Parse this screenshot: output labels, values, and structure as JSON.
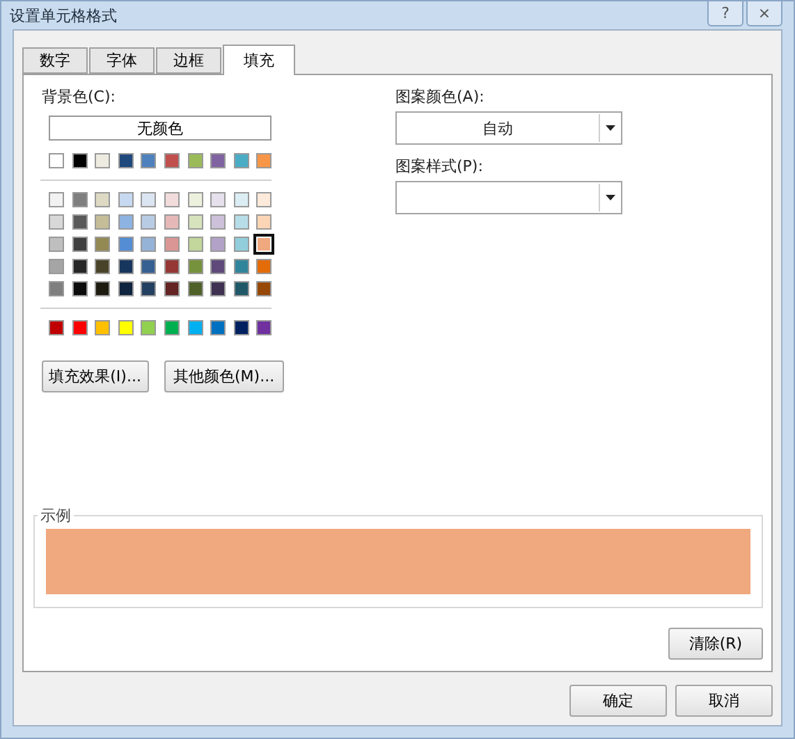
{
  "window": {
    "title": "设置单元格格式",
    "help": "?",
    "close": "×"
  },
  "tabs": [
    {
      "label": "数字",
      "selected": false
    },
    {
      "label": "字体",
      "selected": false
    },
    {
      "label": "边框",
      "selected": false
    },
    {
      "label": "填充",
      "selected": true
    }
  ],
  "background": {
    "label": "背景色(C):",
    "no_color": "无颜色",
    "theme_row": [
      {
        "color": "#ffffff",
        "selected": false
      },
      {
        "color": "#000000",
        "selected": false
      },
      {
        "color": "#eeece1",
        "selected": false
      },
      {
        "color": "#1f497d",
        "selected": false
      },
      {
        "color": "#4f81bd",
        "selected": false
      },
      {
        "color": "#c0504d",
        "selected": false
      },
      {
        "color": "#9bbb59",
        "selected": false
      },
      {
        "color": "#8064a2",
        "selected": false
      },
      {
        "color": "#4bacc6",
        "selected": false
      },
      {
        "color": "#f79646",
        "selected": false
      }
    ],
    "tint_rows": [
      [
        {
          "color": "#f2f2f2",
          "selected": false
        },
        {
          "color": "#7f7f7f",
          "selected": false
        },
        {
          "color": "#ddd9c3",
          "selected": false
        },
        {
          "color": "#c6d9f0",
          "selected": false
        },
        {
          "color": "#dbe5f1",
          "selected": false
        },
        {
          "color": "#f2dcdb",
          "selected": false
        },
        {
          "color": "#ebf1dd",
          "selected": false
        },
        {
          "color": "#e5e0ec",
          "selected": false
        },
        {
          "color": "#dbeef3",
          "selected": false
        },
        {
          "color": "#fdeada",
          "selected": false
        }
      ],
      [
        {
          "color": "#d8d8d8",
          "selected": false
        },
        {
          "color": "#595959",
          "selected": false
        },
        {
          "color": "#c4bd97",
          "selected": false
        },
        {
          "color": "#8db3e2",
          "selected": false
        },
        {
          "color": "#b8cce4",
          "selected": false
        },
        {
          "color": "#e5b9b7",
          "selected": false
        },
        {
          "color": "#d7e3bc",
          "selected": false
        },
        {
          "color": "#ccc1d9",
          "selected": false
        },
        {
          "color": "#b7dde8",
          "selected": false
        },
        {
          "color": "#fbd5b5",
          "selected": false
        }
      ],
      [
        {
          "color": "#bfbfbf",
          "selected": false
        },
        {
          "color": "#3f3f3f",
          "selected": false
        },
        {
          "color": "#938953",
          "selected": false
        },
        {
          "color": "#548dd4",
          "selected": false
        },
        {
          "color": "#95b3d7",
          "selected": false
        },
        {
          "color": "#d99694",
          "selected": false
        },
        {
          "color": "#c3d69b",
          "selected": false
        },
        {
          "color": "#b2a2c7",
          "selected": false
        },
        {
          "color": "#92cddc",
          "selected": false
        },
        {
          "color": "#f0a87e",
          "selected": true
        }
      ],
      [
        {
          "color": "#a5a5a5",
          "selected": false
        },
        {
          "color": "#262626",
          "selected": false
        },
        {
          "color": "#494429",
          "selected": false
        },
        {
          "color": "#17365d",
          "selected": false
        },
        {
          "color": "#366092",
          "selected": false
        },
        {
          "color": "#953734",
          "selected": false
        },
        {
          "color": "#76923c",
          "selected": false
        },
        {
          "color": "#5f497a",
          "selected": false
        },
        {
          "color": "#31859b",
          "selected": false
        },
        {
          "color": "#e36c09",
          "selected": false
        }
      ],
      [
        {
          "color": "#7f7f7f",
          "selected": false
        },
        {
          "color": "#0c0c0c",
          "selected": false
        },
        {
          "color": "#1d1b10",
          "selected": false
        },
        {
          "color": "#0f243e",
          "selected": false
        },
        {
          "color": "#244061",
          "selected": false
        },
        {
          "color": "#632423",
          "selected": false
        },
        {
          "color": "#4f6128",
          "selected": false
        },
        {
          "color": "#3f3151",
          "selected": false
        },
        {
          "color": "#205867",
          "selected": false
        },
        {
          "color": "#974806",
          "selected": false
        }
      ]
    ],
    "standard_row": [
      {
        "color": "#c00000",
        "selected": false
      },
      {
        "color": "#ff0000",
        "selected": false
      },
      {
        "color": "#ffc000",
        "selected": false
      },
      {
        "color": "#ffff00",
        "selected": false
      },
      {
        "color": "#92d050",
        "selected": false
      },
      {
        "color": "#00b050",
        "selected": false
      },
      {
        "color": "#00b0f0",
        "selected": false
      },
      {
        "color": "#0070c0",
        "selected": false
      },
      {
        "color": "#002060",
        "selected": false
      },
      {
        "color": "#7030a0",
        "selected": false
      }
    ],
    "buttons": [
      "填充效果(I)...",
      "其他颜色(M)..."
    ]
  },
  "pattern": {
    "color_label": "图案颜色(A):",
    "color_value": "自动",
    "style_label": "图案样式(P):"
  },
  "sample": {
    "label": "示例"
  },
  "clear_button": "清除(R)",
  "footer_buttons": [
    "确定",
    "取消"
  ]
}
